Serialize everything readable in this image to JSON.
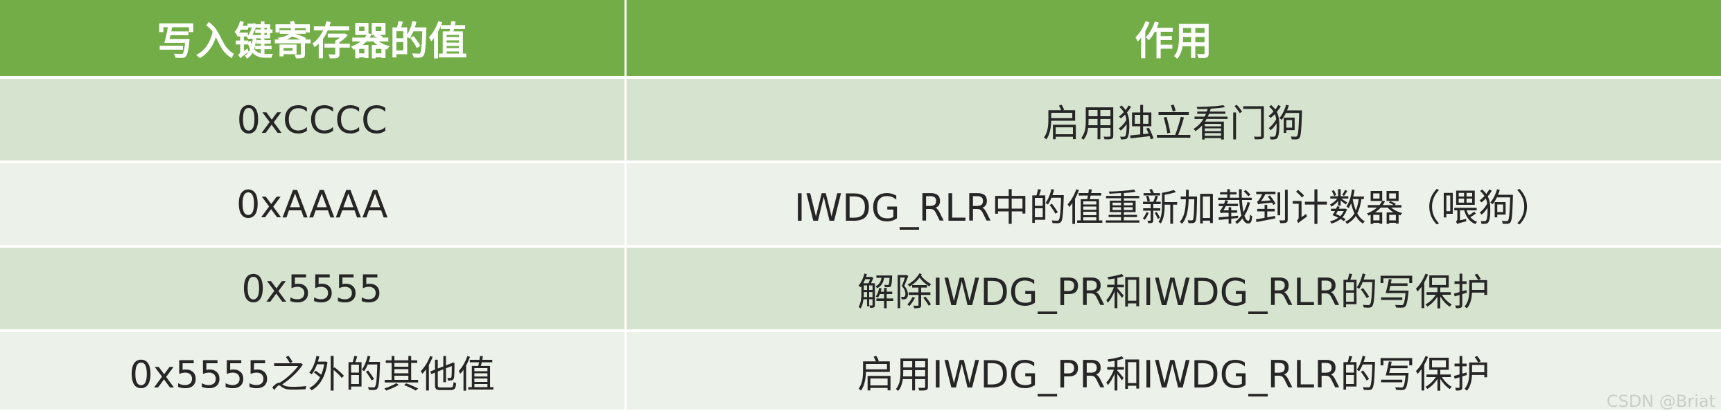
{
  "table": {
    "headers": [
      "写入键寄存器的值",
      "作用"
    ],
    "rows": [
      {
        "value": "0xCCCC",
        "effect": "启用独立看门狗"
      },
      {
        "value": "0xAAAA",
        "effect": "IWDG_RLR中的值重新加载到计数器（喂狗）"
      },
      {
        "value": "0x5555",
        "effect": "解除IWDG_PR和IWDG_RLR的写保护"
      },
      {
        "value": "0x5555之外的其他值",
        "effect": "启用IWDG_PR和IWDG_RLR的写保护"
      }
    ]
  },
  "colors": {
    "header_bg": "#72ad47",
    "row_odd_bg": "#d6e3cf",
    "row_even_bg": "#ecf1e9"
  },
  "watermark": "CSDN @Briat"
}
